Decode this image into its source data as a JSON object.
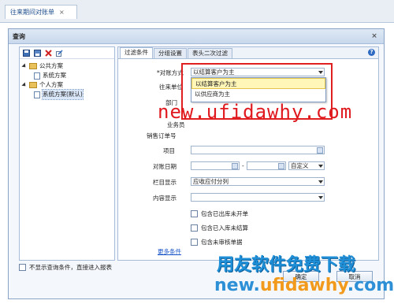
{
  "tab": {
    "label": "往来期间对账单",
    "close": "×"
  },
  "dialog": {
    "title": "查询",
    "close": "×"
  },
  "tree": [
    {
      "label": "公共方案",
      "level": 1,
      "type": "folder"
    },
    {
      "label": "系统方案",
      "level": 2,
      "type": "leaf"
    },
    {
      "label": "个人方案",
      "level": 1,
      "type": "folder"
    },
    {
      "label": "系统方案(默认)",
      "level": 2,
      "type": "leaf"
    }
  ],
  "right_tabs": [
    "过滤条件",
    "分组设置",
    "表头二次过滤"
  ],
  "form": {
    "recon_mode_label": "*对账方式",
    "recon_mode_value": "以结算客户为主",
    "unit_label": "往来单位",
    "dept_label": "部门",
    "salesman_label": "业务员",
    "sales_order_label": "销售订单号",
    "project_label": "项目",
    "date_label": "对账日期",
    "date_sep": "-",
    "date_option": "自定义",
    "column_label": "栏目显示",
    "column_value": "应收应付分列",
    "content_label": "内容显示",
    "checkboxes": [
      "包含已出库未开单",
      "包含已入库未结算",
      "包含未审核单据"
    ],
    "more": "更多条件"
  },
  "dropdown_options": [
    "以结算客户为主",
    "以供应商为主"
  ],
  "bottom_checkbox": "不显示查询条件，直接进入报表",
  "buttons": {
    "ok": "确定",
    "cancel": "取消"
  },
  "watermarks": {
    "url_red": "new.ufidawhy.com",
    "brand": "用友软件免费下载",
    "url_blue_a": "new.",
    "url_blue_b": "ufidawhy",
    "url_blue_c": ".com"
  }
}
